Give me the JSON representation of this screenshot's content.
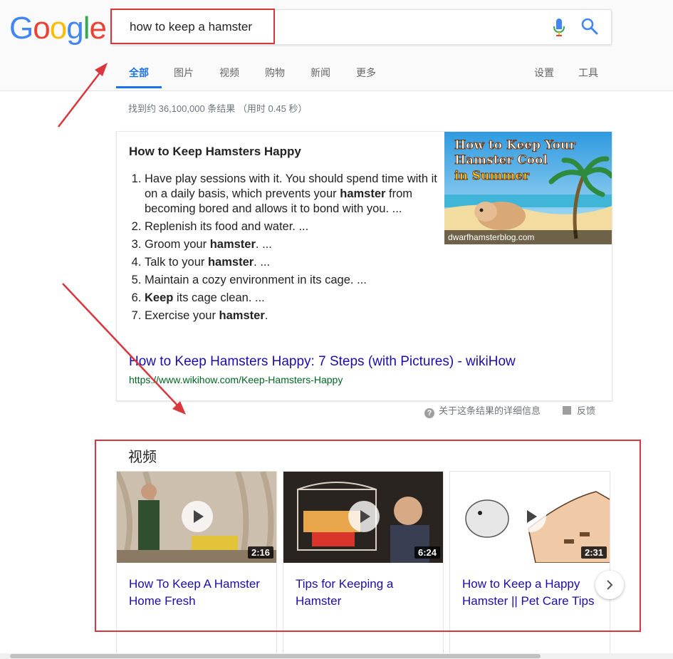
{
  "logo": {
    "letters": [
      "G",
      "o",
      "o",
      "g",
      "l",
      "e"
    ],
    "colors": [
      "#4285f4",
      "#ea4335",
      "#fbbc05",
      "#4285f4",
      "#34a853",
      "#ea4335"
    ]
  },
  "search": {
    "value": "how to keep a hamster"
  },
  "tabs": [
    {
      "label": "全部",
      "active": true
    },
    {
      "label": "图片"
    },
    {
      "label": "视频"
    },
    {
      "label": "购物"
    },
    {
      "label": "新闻"
    },
    {
      "label": "更多"
    }
  ],
  "tools": {
    "settings": "设置",
    "tools": "工具"
  },
  "stats": "找到约 36,100,000 条结果 （用时 0.45 秒）",
  "snippet": {
    "title": "How to Keep Hamsters Happy",
    "steps": [
      [
        {
          "t": "Have play sessions with it. You should spend time with it on a daily basis, which prevents your "
        },
        {
          "t": "hamster",
          "b": true
        },
        {
          "t": " from becoming bored and allows it to bond with you. ..."
        }
      ],
      [
        {
          "t": "Replenish its food and water. ..."
        }
      ],
      [
        {
          "t": "Groom your "
        },
        {
          "t": "hamster",
          "b": true
        },
        {
          "t": ". ..."
        }
      ],
      [
        {
          "t": "Talk to your "
        },
        {
          "t": "hamster",
          "b": true
        },
        {
          "t": ". ..."
        }
      ],
      [
        {
          "t": "Maintain a cozy environment in its cage. ..."
        }
      ],
      [
        {
          "t": "Keep",
          "b": true
        },
        {
          "t": " its cage clean. ..."
        }
      ],
      [
        {
          "t": "Exercise your "
        },
        {
          "t": "hamster",
          "b": true
        },
        {
          "t": "."
        }
      ]
    ],
    "image": {
      "title_lines": [
        "How to Keep Your",
        "Hamster Cool",
        "in Summer"
      ],
      "caption": "dwarfhamsterblog.com"
    },
    "link_text": "How to Keep Hamsters Happy: 7 Steps (with Pictures) - wikiHow",
    "url": "https://www.wikihow.com/Keep-Hamsters-Happy"
  },
  "about": {
    "info": "关于这条结果的详细信息",
    "feedback": "反馈"
  },
  "videos": {
    "heading": "视频",
    "items": [
      {
        "title": "How To Keep A Hamster Home Fresh",
        "duration": "2:16"
      },
      {
        "title": "Tips for Keeping a Hamster",
        "duration": "6:24"
      },
      {
        "title": "How to Keep a Happy Hamster || Pet Care Tips",
        "duration": "2:31"
      }
    ]
  },
  "accent": "#1a73e8",
  "annotation_color": "#d9363e"
}
